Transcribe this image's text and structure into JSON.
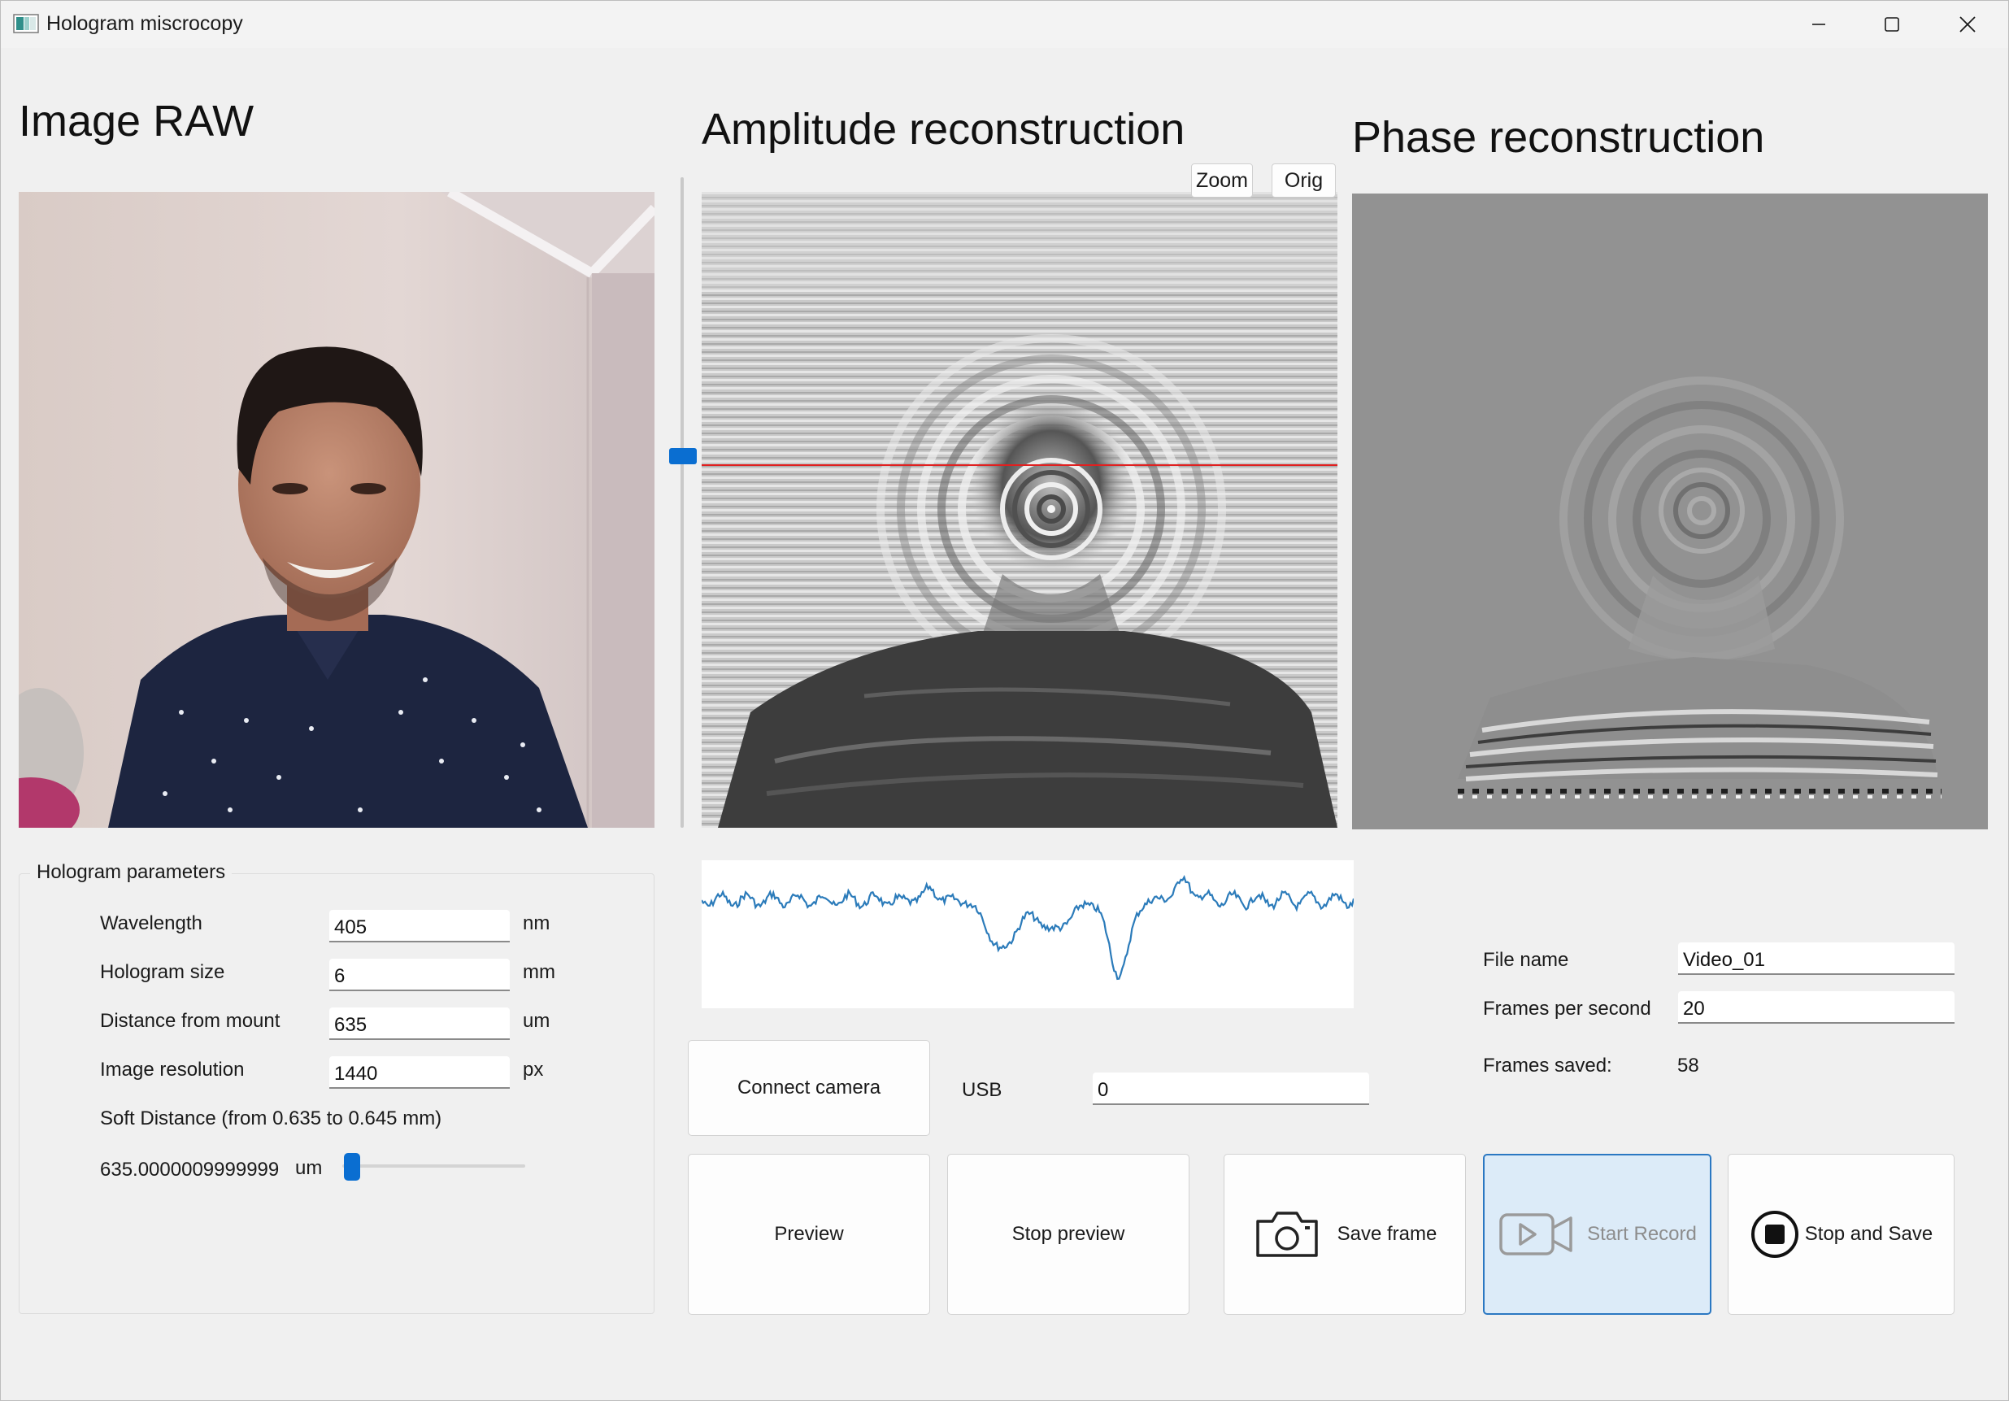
{
  "window": {
    "title": "Hologram miscrocopy",
    "controls": {
      "minimize": "minimize",
      "maximize": "maximize",
      "close": "close"
    }
  },
  "headings": {
    "raw": "Image RAW",
    "amplitude": "Amplitude reconstruction",
    "phase": "Phase reconstruction"
  },
  "zoom_buttons": {
    "zoom": "Zoom",
    "orig": "Orig"
  },
  "line_selector": {
    "position": 0.43
  },
  "parameters": {
    "title": "Hologram parameters",
    "rows": [
      {
        "label": "Wavelength",
        "value": "405",
        "unit": "nm"
      },
      {
        "label": "Hologram size",
        "value": "6",
        "unit": "mm"
      },
      {
        "label": "Distance from mount",
        "value": "635",
        "unit": "um"
      },
      {
        "label": "Image resolution",
        "value": "1440",
        "unit": "px"
      }
    ],
    "soft_distance_label": "Soft Distance (from 0.635 to 0.645 mm)",
    "soft_distance_value": "635.0000009999999",
    "soft_distance_unit": "um",
    "soft_distance_fraction": 0.0
  },
  "camera": {
    "connect_label": "Connect camera",
    "usb_label": "USB",
    "usb_value": "0"
  },
  "recording": {
    "file_name_label": "File name",
    "file_name_value": "Video_01",
    "fps_label": "Frames per second",
    "fps_value": "20",
    "frames_saved_label": "Frames saved:",
    "frames_saved_value": "58"
  },
  "buttons": {
    "preview": "Preview",
    "stop_preview": "Stop preview",
    "save_frame": "Save frame",
    "start_record": "Start Record",
    "stop_and_save": "Stop and Save"
  },
  "colors": {
    "accent": "#0a6ed1",
    "profile_line": "#2b7bba",
    "scan_line": "#e02020",
    "disabled_bg": "#dcebf8"
  }
}
